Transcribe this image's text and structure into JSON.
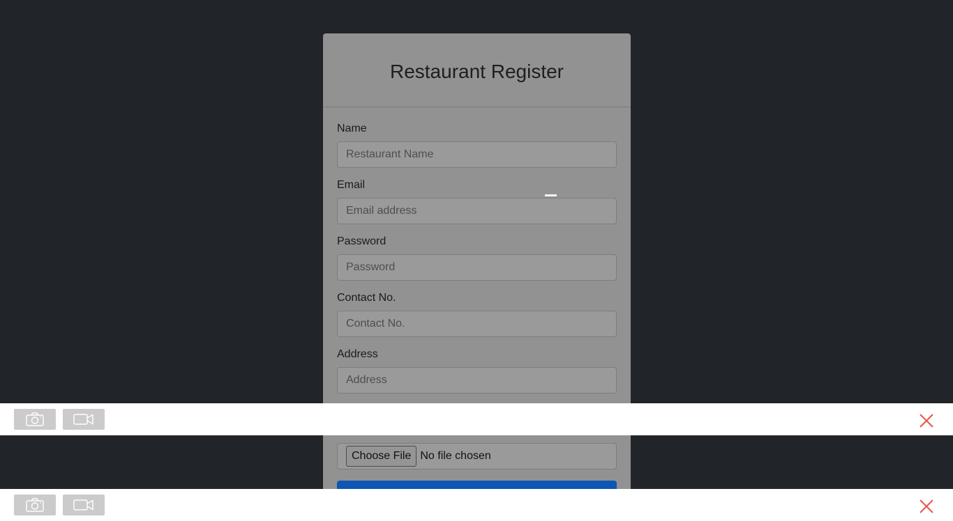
{
  "form": {
    "title": "Restaurant Register",
    "fields": [
      {
        "label": "Name",
        "placeholder": "Restaurant Name"
      },
      {
        "label": "Email",
        "placeholder": "Email address"
      },
      {
        "label": "Password",
        "placeholder": "Password"
      },
      {
        "label": "Contact No.",
        "placeholder": "Contact No."
      },
      {
        "label": "Address",
        "placeholder": "Address"
      }
    ],
    "file": {
      "button_label": "Choose File",
      "status": "No file chosen"
    }
  },
  "overlay": {
    "screenshot_icon": "camera-icon",
    "record_icon": "video-camera-icon",
    "close_icon": "close-icon",
    "close_color": "#e8564a"
  }
}
